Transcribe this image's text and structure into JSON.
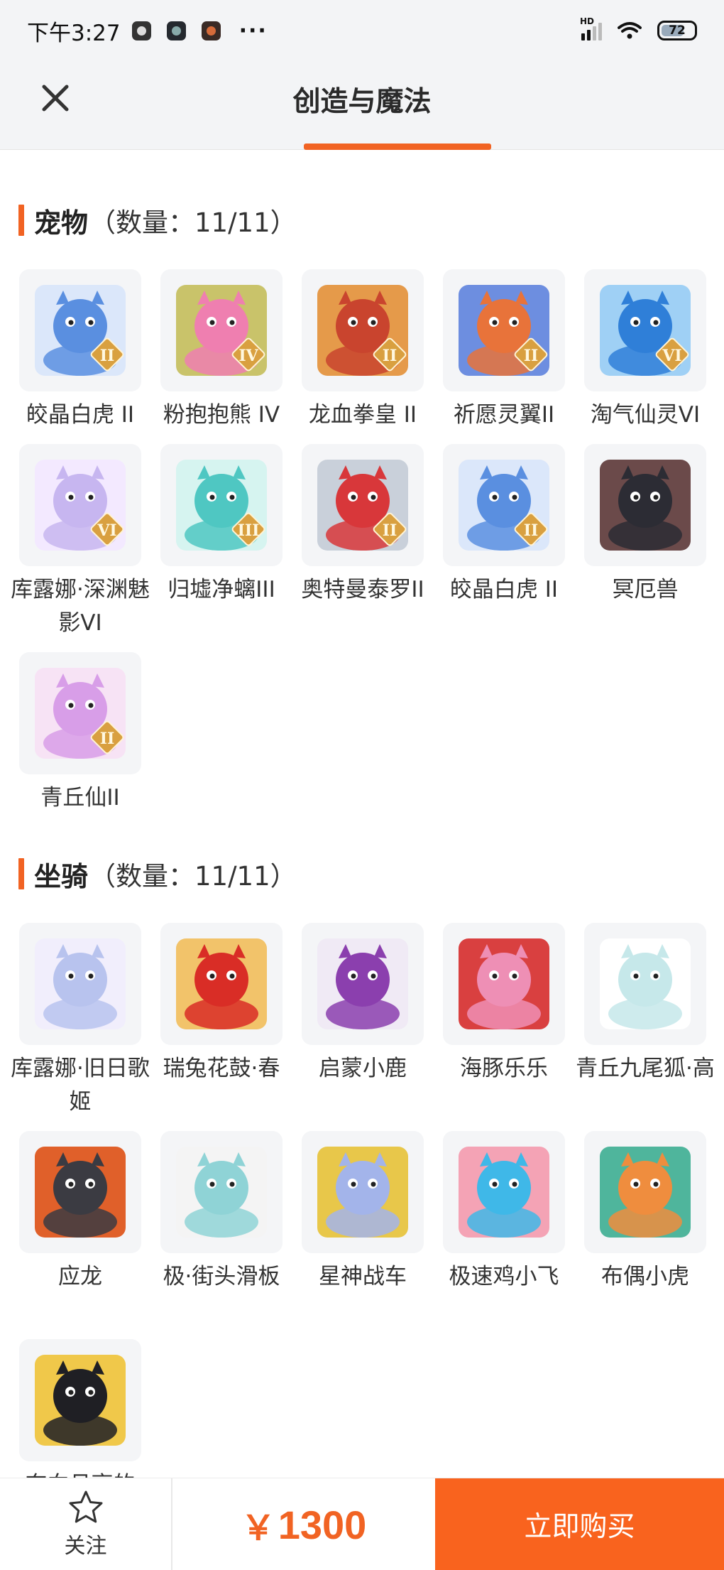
{
  "status_bar": {
    "time": "下午3:27",
    "more": "···",
    "network": "HD",
    "battery": "72"
  },
  "header": {
    "title": "创造与魔法",
    "close_icon": "close-icon"
  },
  "sections": [
    {
      "name": "宠物",
      "count": "（数量：11/11）",
      "items": [
        {
          "label": "皎晶白虎 II",
          "icon": "white-tiger-icon",
          "badge": "II",
          "colors": [
            "#5a8fe0",
            "#dbe7fa"
          ]
        },
        {
          "label": "粉抱抱熊 IV",
          "icon": "pink-bear-icon",
          "badge": "IV",
          "colors": [
            "#ef7fb0",
            "#c9c36a"
          ]
        },
        {
          "label": "龙血拳皇 II",
          "icon": "dragon-fist-icon",
          "badge": "II",
          "colors": [
            "#c9442e",
            "#e59a4a"
          ]
        },
        {
          "label": "祈愿灵翼II",
          "icon": "spirit-bird-icon",
          "badge": "II",
          "colors": [
            "#e8733a",
            "#6d8ee0"
          ]
        },
        {
          "label": "淘气仙灵VI",
          "icon": "blue-puppy-icon",
          "badge": "VI",
          "colors": [
            "#2f7fd8",
            "#9fd0f5"
          ]
        },
        {
          "label": "库露娜·深渊魅影VI",
          "icon": "fairy-girl-icon",
          "badge": "VI",
          "colors": [
            "#c7b6f0",
            "#f3e9ff"
          ]
        },
        {
          "label": "归墟净螭III",
          "icon": "jade-dragon-icon",
          "badge": "III",
          "colors": [
            "#4fc7c2",
            "#d6f4f0"
          ]
        },
        {
          "label": "奥特曼泰罗II",
          "icon": "ultraman-icon",
          "badge": "II",
          "colors": [
            "#d8373a",
            "#c9d0da"
          ]
        },
        {
          "label": "皎晶白虎 II",
          "icon": "white-tiger-icon",
          "badge": "II",
          "colors": [
            "#5a8fe0",
            "#dbe7fa"
          ]
        },
        {
          "label": "冥厄兽",
          "icon": "dark-beast-icon",
          "badge": "",
          "colors": [
            "#2c2c34",
            "#6b4a4a"
          ]
        },
        {
          "label": "青丘仙II",
          "icon": "fox-fairy-icon",
          "badge": "II",
          "colors": [
            "#d89ee8",
            "#f7e3f5"
          ]
        }
      ]
    },
    {
      "name": "坐骑",
      "count": "（数量：11/11）",
      "items": [
        {
          "label": "库露娜·旧日歌姬",
          "icon": "singer-girl-icon",
          "badge": "",
          "colors": [
            "#b8c3ee",
            "#f1eefc"
          ]
        },
        {
          "label": "瑞兔花鼓·春",
          "icon": "drum-rabbit-icon",
          "badge": "",
          "colors": [
            "#d92d26",
            "#f2c36a"
          ]
        },
        {
          "label": "启蒙小鹿",
          "icon": "white-deer-icon",
          "badge": "",
          "colors": [
            "#8b3fae",
            "#f0eaf5"
          ]
        },
        {
          "label": "海豚乐乐",
          "icon": "pink-dolphin-icon",
          "badge": "",
          "colors": [
            "#ee8fb5",
            "#d94040"
          ]
        },
        {
          "label": "青丘九尾狐·高",
          "icon": "nine-tail-fox-icon",
          "badge": "",
          "colors": [
            "#c6e8ea",
            "#ffffff"
          ]
        },
        {
          "label": "应龙",
          "icon": "winged-dragon-icon",
          "badge": "",
          "colors": [
            "#3b3b42",
            "#e0602a"
          ]
        },
        {
          "label": "极·街头滑板",
          "icon": "skateboard-icon",
          "badge": "",
          "colors": [
            "#8fd3d6",
            "#f4f4f4"
          ]
        },
        {
          "label": "星神战车",
          "icon": "star-horse-icon",
          "badge": "",
          "colors": [
            "#a3b4ea",
            "#e8c74a"
          ]
        },
        {
          "label": "极速鸡小飞",
          "icon": "blue-chick-icon",
          "badge": "",
          "colors": [
            "#3fb8e8",
            "#f4a3b5"
          ]
        },
        {
          "label": "布偶小虎",
          "icon": "plush-tiger-icon",
          "badge": "",
          "colors": [
            "#ef8d3e",
            "#4fb59c"
          ]
        },
        {
          "label": "奔向月亮的",
          "icon": "black-pig-icon",
          "badge": "",
          "colors": [
            "#1f1f24",
            "#f0c84a"
          ]
        }
      ]
    }
  ],
  "footer": {
    "follow_label": "关注",
    "currency": "￥",
    "price": "1300",
    "buy_label": "立即购买"
  },
  "colors": {
    "accent": "#f16323",
    "buy_bg": "#f9631e",
    "badge_gold": "#d9a040"
  }
}
